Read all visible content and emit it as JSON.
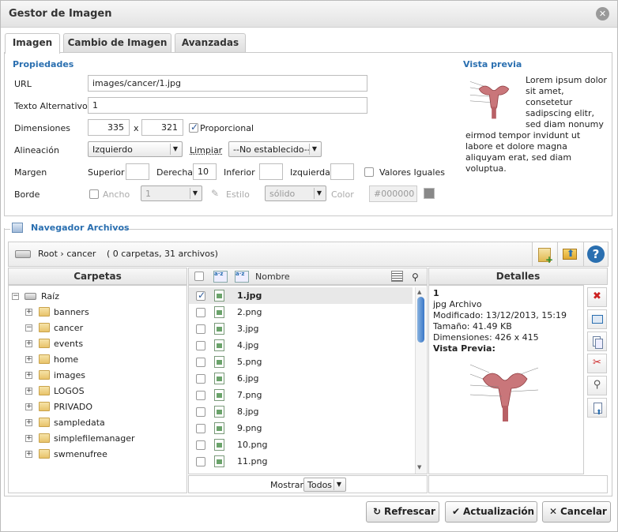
{
  "window": {
    "title": "Gestor de Imagen",
    "close_icon": "close-icon"
  },
  "tabs": [
    {
      "label": "Imagen",
      "active": true
    },
    {
      "label": "Cambio de Imagen",
      "active": false
    },
    {
      "label": "Avanzadas",
      "active": false
    }
  ],
  "properties": {
    "heading": "Propiedades",
    "url_label": "URL",
    "url_value": "images/cancer/1.jpg",
    "alt_label": "Texto Alternativo",
    "alt_value": "1",
    "dim_label": "Dimensiones",
    "width": "335",
    "times": "x",
    "height": "321",
    "proportional_label": "Proporcional",
    "proportional_checked": true,
    "align_label": "Alineación",
    "align_value": "Izquierdo",
    "clear_label": "Limpiar",
    "clear_value": "--No establecido--",
    "margin_label": "Margen",
    "margin_top_label": "Superior",
    "margin_top": "",
    "margin_right_label": "Derecha",
    "margin_right": "10",
    "margin_bottom_label": "Inferior",
    "margin_bottom": "",
    "margin_left_label": "Izquierda",
    "margin_left": "",
    "equal_values_label": "Valores Iguales",
    "border_label": "Borde",
    "border_width_label": "Ancho",
    "border_width_value": "1",
    "border_style_label": "Estilo",
    "border_style_value": "sólido",
    "border_color_label": "Color",
    "border_color_value": "#000000"
  },
  "preview": {
    "heading": "Vista previa",
    "text": "Lorem ipsum dolor sit amet, consetetur sadipscing elitr, sed diam nonumy eirmod tempor invidunt ut labore et dolore magna aliquyam erat, sed diam voluptua."
  },
  "browser": {
    "heading": "Navegador Archivos",
    "path_root": "Root",
    "path_sep": "›",
    "path_current": "cancer",
    "summary": "( 0 carpetas, 31 archivos)",
    "folders_header": "Carpetas",
    "name_header": "Nombre",
    "details_header": "Detalles",
    "tree_root": "Raíz",
    "folders": [
      "banners",
      "cancer",
      "events",
      "home",
      "images",
      "LOGOS",
      "PRIVADO",
      "sampledata",
      "simplefilemanager",
      "swmenufree"
    ],
    "files": [
      "1.jpg",
      "2.png",
      "3.jpg",
      "4.jpg",
      "5.png",
      "6.jpg",
      "7.png",
      "8.jpg",
      "9.png",
      "10.png",
      "11.png"
    ],
    "selected_file": "1.jpg",
    "show_label": "Mostrar",
    "show_value": "Todos"
  },
  "details": {
    "name": "1",
    "type": "jpg Archivo",
    "modified": "Modificado: 13/12/2013, 15:19",
    "size": "Tamaño: 41.49 KB",
    "dimensions": "Dimensiones: 426 x 415",
    "preview_label": "Vista Previa:"
  },
  "buttons": {
    "refresh": "Refrescar",
    "update": "Actualización",
    "cancel": "Cancelar"
  },
  "colors": {
    "accent": "#2a6fb0",
    "delete": "#cc2222"
  }
}
